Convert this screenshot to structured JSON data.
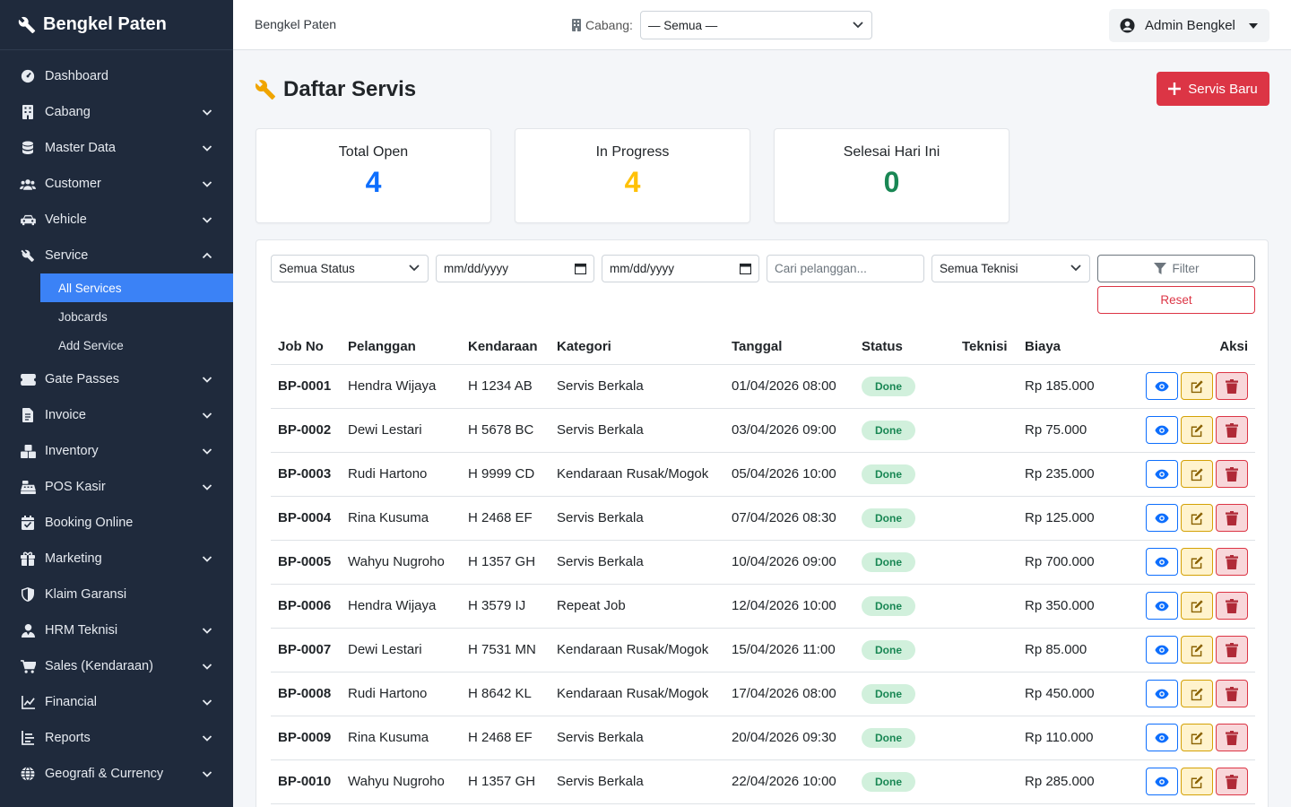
{
  "brand": "Bengkel Paten",
  "sidebar": {
    "items": [
      {
        "label": "Dashboard",
        "icon": "gauge-icon",
        "chevron": false
      },
      {
        "label": "Cabang",
        "icon": "building-icon",
        "chevron": true
      },
      {
        "label": "Master Data",
        "icon": "database-icon",
        "chevron": true
      },
      {
        "label": "Customer",
        "icon": "users-icon",
        "chevron": true
      },
      {
        "label": "Vehicle",
        "icon": "car-icon",
        "chevron": true
      },
      {
        "label": "Service",
        "icon": "tools-icon",
        "chevron": true,
        "expanded": true
      }
    ],
    "service_sub": [
      {
        "label": "All Services",
        "active": true
      },
      {
        "label": "Jobcards",
        "active": false
      },
      {
        "label": "Add Service",
        "active": false
      }
    ],
    "items2": [
      {
        "label": "Gate Passes",
        "icon": "ticket-icon",
        "chevron": true
      },
      {
        "label": "Invoice",
        "icon": "invoice-icon",
        "chevron": true
      },
      {
        "label": "Inventory",
        "icon": "boxes-icon",
        "chevron": true
      },
      {
        "label": "POS Kasir",
        "icon": "cash-register-icon",
        "chevron": true
      },
      {
        "label": "Booking Online",
        "icon": "calendar-check-icon",
        "chevron": false
      },
      {
        "label": "Marketing",
        "icon": "gift-icon",
        "chevron": true
      },
      {
        "label": "Klaim Garansi",
        "icon": "shield-icon",
        "chevron": false
      },
      {
        "label": "HRM Teknisi",
        "icon": "user-tie-icon",
        "chevron": true
      },
      {
        "label": "Sales (Kendaraan)",
        "icon": "cart-icon",
        "chevron": true
      },
      {
        "label": "Financial",
        "icon": "chart-line-icon",
        "chevron": true
      },
      {
        "label": "Reports",
        "icon": "report-icon",
        "chevron": true
      },
      {
        "label": "Geografi & Currency",
        "icon": "globe-icon",
        "chevron": true
      }
    ]
  },
  "topbar": {
    "title": "Bengkel Paten",
    "branch_label": "Cabang:",
    "branch_value": "— Semua —",
    "user": "Admin Bengkel"
  },
  "page": {
    "title": "Daftar Servis",
    "new_button": "Servis Baru"
  },
  "stats": [
    {
      "label": "Total Open",
      "value": "4",
      "color": "#0d6efd"
    },
    {
      "label": "In Progress",
      "value": "4",
      "color": "#ffc107"
    },
    {
      "label": "Selesai Hari Ini",
      "value": "0",
      "color": "#198754"
    }
  ],
  "filters": {
    "status": "Semua Status",
    "date_from": "mm/dd/yyyy",
    "date_to": "mm/dd/yyyy",
    "search_placeholder": "Cari pelanggan...",
    "teknisi": "Semua Teknisi",
    "filter_label": "Filter",
    "reset_label": "Reset"
  },
  "table": {
    "headers": [
      "Job No",
      "Pelanggan",
      "Kendaraan",
      "Kategori",
      "Tanggal",
      "Status",
      "Teknisi",
      "Biaya",
      "Aksi"
    ],
    "rows": [
      {
        "job": "BP-0001",
        "pelanggan": "Hendra Wijaya",
        "kendaraan": "H 1234 AB",
        "kategori": "Servis Berkala",
        "tanggal": "01/04/2026 08:00",
        "status": "Done",
        "teknisi": "",
        "biaya": "Rp 185.000"
      },
      {
        "job": "BP-0002",
        "pelanggan": "Dewi Lestari",
        "kendaraan": "H 5678 BC",
        "kategori": "Servis Berkala",
        "tanggal": "03/04/2026 09:00",
        "status": "Done",
        "teknisi": "",
        "biaya": "Rp 75.000"
      },
      {
        "job": "BP-0003",
        "pelanggan": "Rudi Hartono",
        "kendaraan": "H 9999 CD",
        "kategori": "Kendaraan Rusak/Mogok",
        "tanggal": "05/04/2026 10:00",
        "status": "Done",
        "teknisi": "",
        "biaya": "Rp 235.000"
      },
      {
        "job": "BP-0004",
        "pelanggan": "Rina Kusuma",
        "kendaraan": "H 2468 EF",
        "kategori": "Servis Berkala",
        "tanggal": "07/04/2026 08:30",
        "status": "Done",
        "teknisi": "",
        "biaya": "Rp 125.000"
      },
      {
        "job": "BP-0005",
        "pelanggan": "Wahyu Nugroho",
        "kendaraan": "H 1357 GH",
        "kategori": "Servis Berkala",
        "tanggal": "10/04/2026 09:00",
        "status": "Done",
        "teknisi": "",
        "biaya": "Rp 700.000"
      },
      {
        "job": "BP-0006",
        "pelanggan": "Hendra Wijaya",
        "kendaraan": "H 3579 IJ",
        "kategori": "Repeat Job",
        "tanggal": "12/04/2026 10:00",
        "status": "Done",
        "teknisi": "",
        "biaya": "Rp 350.000"
      },
      {
        "job": "BP-0007",
        "pelanggan": "Dewi Lestari",
        "kendaraan": "H 7531 MN",
        "kategori": "Kendaraan Rusak/Mogok",
        "tanggal": "15/04/2026 11:00",
        "status": "Done",
        "teknisi": "",
        "biaya": "Rp 85.000"
      },
      {
        "job": "BP-0008",
        "pelanggan": "Rudi Hartono",
        "kendaraan": "H 8642 KL",
        "kategori": "Kendaraan Rusak/Mogok",
        "tanggal": "17/04/2026 08:00",
        "status": "Done",
        "teknisi": "",
        "biaya": "Rp 450.000"
      },
      {
        "job": "BP-0009",
        "pelanggan": "Rina Kusuma",
        "kendaraan": "H 2468 EF",
        "kategori": "Servis Berkala",
        "tanggal": "20/04/2026 09:30",
        "status": "Done",
        "teknisi": "",
        "biaya": "Rp 110.000"
      },
      {
        "job": "BP-0010",
        "pelanggan": "Wahyu Nugroho",
        "kendaraan": "H 1357 GH",
        "kategori": "Servis Berkala",
        "tanggal": "22/04/2026 10:00",
        "status": "Done",
        "teknisi": "",
        "biaya": "Rp 285.000"
      }
    ]
  }
}
